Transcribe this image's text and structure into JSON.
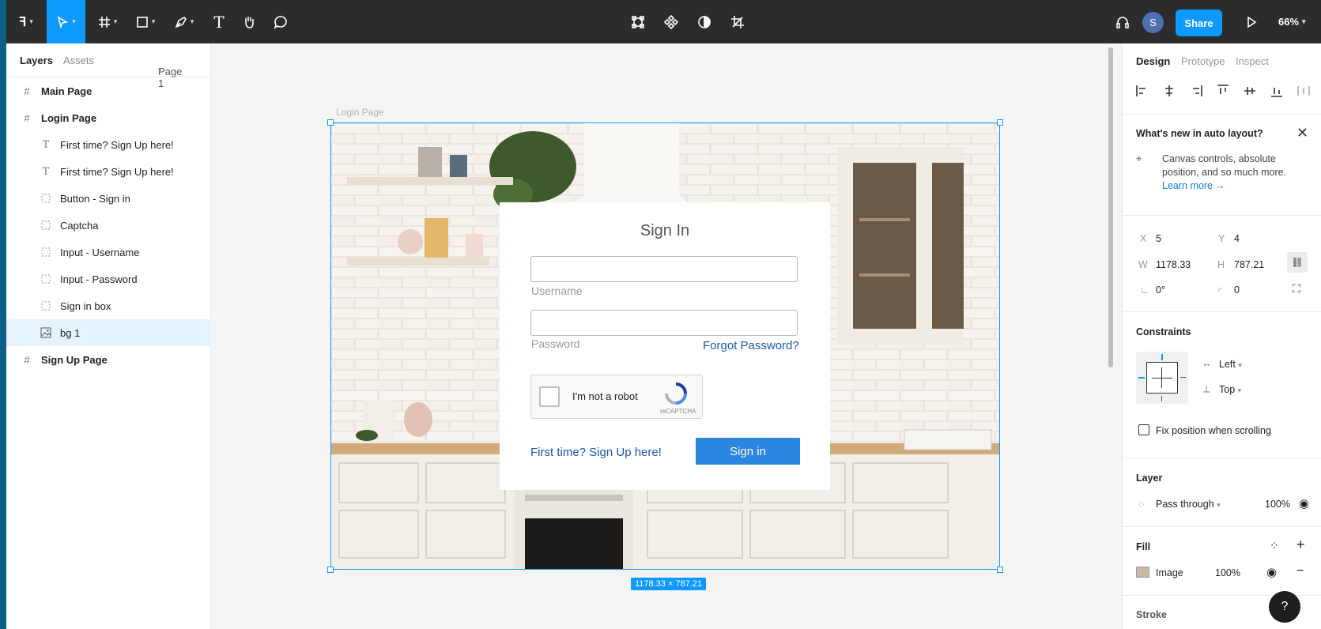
{
  "toolbar": {
    "logo": "figma-logo-icon",
    "share_label": "Share",
    "avatar_initial": "S",
    "zoom": "66%"
  },
  "left_panel": {
    "tabs": {
      "layers": "Layers",
      "assets": "Assets",
      "page": "Page 1"
    },
    "layers": [
      {
        "label": "Main Page",
        "type": "frame"
      },
      {
        "label": "Login Page",
        "type": "frame"
      },
      {
        "label": "First time? Sign Up here!",
        "type": "text"
      },
      {
        "label": "First time? Sign Up here!",
        "type": "text"
      },
      {
        "label": "Button - Sign in",
        "type": "group"
      },
      {
        "label": "Captcha",
        "type": "group"
      },
      {
        "label": "Input - Username",
        "type": "group"
      },
      {
        "label": "Input - Password",
        "type": "group"
      },
      {
        "label": "Sign in box",
        "type": "group"
      },
      {
        "label": "bg 1",
        "type": "image",
        "selected": true
      },
      {
        "label": "Sign Up Page",
        "type": "frame"
      }
    ]
  },
  "canvas": {
    "frame_label": "Login Page",
    "dimensions": "1178.33 × 787.21",
    "signin": {
      "title": "Sign In",
      "username_label": "Username",
      "password_label": "Password",
      "forgot": "Forgot Password?",
      "captcha_text": "I'm not a robot",
      "captcha_brand": "reCAPTCHA",
      "signup_link": "First time? Sign Up here!",
      "button": "Sign in"
    }
  },
  "right_panel": {
    "tabs": {
      "design": "Design",
      "prototype": "Prototype",
      "inspect": "Inspect"
    },
    "whats_new": {
      "title": "What's new in auto layout?",
      "body": "Canvas controls, absolute position, and so much more.",
      "link": "Learn more →"
    },
    "props": {
      "x_label": "X",
      "x": "5",
      "y_label": "Y",
      "y": "4",
      "w_label": "W",
      "w": "1178.33",
      "h_label": "H",
      "h": "787.21",
      "rotation": "0°",
      "radius": "0"
    },
    "constraints": {
      "title": "Constraints",
      "horizontal": "Left",
      "vertical": "Top",
      "fix_label": "Fix position when scrolling"
    },
    "layer": {
      "title": "Layer",
      "blend": "Pass through",
      "opacity": "100%"
    },
    "fill": {
      "title": "Fill",
      "type": "Image",
      "opacity": "100%"
    },
    "stroke": {
      "title": "Stroke"
    }
  },
  "colors": {
    "accent": "#0d99ff",
    "toolbar_bg": "#2c2c2c",
    "link": "#1a5aa8",
    "button": "#2b86e0"
  }
}
